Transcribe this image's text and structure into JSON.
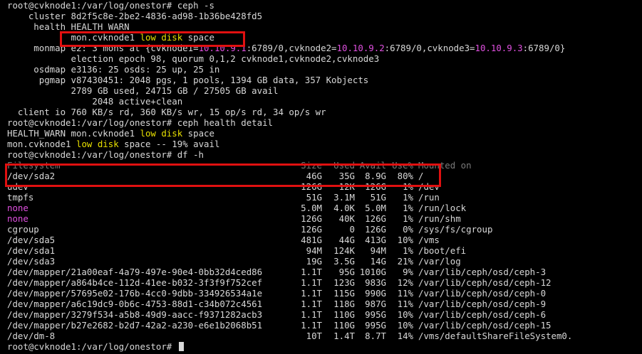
{
  "prompt": "root@cvknode1:/var/log/onestor#",
  "lines": [
    {
      "segs": [
        {
          "t": "root@cvknode1:/var/log/onestor# ceph -s"
        }
      ]
    },
    {
      "segs": [
        {
          "t": "    cluster 8d2f5c8e-2be2-4836-ad98-1b36be428fd5"
        }
      ]
    },
    {
      "segs": [
        {
          "t": "     health HEALTH_WARN"
        }
      ]
    },
    {
      "segs": [
        {
          "t": "            mon.cvknode1 "
        },
        {
          "t": "low disk",
          "c": "yellow"
        },
        {
          "t": " space"
        }
      ]
    },
    {
      "segs": [
        {
          "t": "     monmap e2: 3 mons at {cvknode1="
        },
        {
          "t": "10.10.9.1",
          "c": "magenta"
        },
        {
          "t": ":6789/0,cvknode2="
        },
        {
          "t": "10.10.9.2",
          "c": "magenta"
        },
        {
          "t": ":6789/0,cvknode3="
        },
        {
          "t": "10.10.9.3",
          "c": "magenta"
        },
        {
          "t": ":6789/0}"
        }
      ]
    },
    {
      "segs": [
        {
          "t": "            election epoch 98, quorum 0,1,2 cvknode1,cvknode2,cvknode3"
        }
      ]
    },
    {
      "segs": [
        {
          "t": "     osdmap e3136: 25 osds: 25 up, 25 in"
        }
      ]
    },
    {
      "segs": [
        {
          "t": "      pgmap v87430451: 2048 pgs, 1 pools, 1394 GB data, 357 Kobjects"
        }
      ]
    },
    {
      "segs": [
        {
          "t": "            2789 GB used, 24715 GB / 27505 GB avail"
        }
      ]
    },
    {
      "segs": [
        {
          "t": "                2048 active+clean"
        }
      ]
    },
    {
      "segs": [
        {
          "t": "  client io 760 KB/s rd, 360 KB/s wr, 15 op/s rd, 34 op/s wr"
        }
      ]
    },
    {
      "segs": [
        {
          "t": "root@cvknode1:/var/log/onestor# ceph health detail"
        }
      ]
    },
    {
      "segs": [
        {
          "t": "HEALTH_WARN mon.cvknode1 "
        },
        {
          "t": "low disk",
          "c": "yellow"
        },
        {
          "t": " space"
        }
      ]
    },
    {
      "segs": [
        {
          "t": "mon.cvknode1 "
        },
        {
          "t": "low disk",
          "c": "yellow"
        },
        {
          "t": " space -- 19% avail"
        }
      ]
    },
    {
      "segs": [
        {
          "t": "root@cvknode1:/var/log/onestor# df -h"
        }
      ]
    }
  ],
  "df": {
    "header": {
      "fs": "Filesystem",
      "size": "Size",
      "used": "Used",
      "avail": "Avail",
      "pct": "Use%",
      "mnt": "Mounted on"
    },
    "rows": [
      {
        "fs": "/dev/sda2",
        "size": "46G",
        "used": "35G",
        "avail": "8.9G",
        "pct": "80%",
        "mnt": "/"
      },
      {
        "fs": "udev",
        "size": "126G",
        "used": "12K",
        "avail": "126G",
        "pct": "1%",
        "mnt": "/dev"
      },
      {
        "fs": "tmpfs",
        "size": "51G",
        "used": "3.1M",
        "avail": "51G",
        "pct": "1%",
        "mnt": "/run"
      },
      {
        "fs": "none",
        "size": "5.0M",
        "used": "4.0K",
        "avail": "5.0M",
        "pct": "1%",
        "mnt": "/run/lock",
        "fsColor": "magenta"
      },
      {
        "fs": "none",
        "size": "126G",
        "used": "40K",
        "avail": "126G",
        "pct": "1%",
        "mnt": "/run/shm",
        "fsColor": "magenta"
      },
      {
        "fs": "cgroup",
        "size": "126G",
        "used": "0",
        "avail": "126G",
        "pct": "0%",
        "mnt": "/sys/fs/cgroup"
      },
      {
        "fs": "/dev/sda5",
        "size": "481G",
        "used": "44G",
        "avail": "413G",
        "pct": "10%",
        "mnt": "/vms"
      },
      {
        "fs": "/dev/sda1",
        "size": "94M",
        "used": "124K",
        "avail": "94M",
        "pct": "1%",
        "mnt": "/boot/efi"
      },
      {
        "fs": "/dev/sda3",
        "size": "19G",
        "used": "3.5G",
        "avail": "14G",
        "pct": "21%",
        "mnt": "/var/log"
      },
      {
        "fs": "/dev/mapper/21a00eaf-4a79-497e-90e4-0bb32d4ced86",
        "size": "1.1T",
        "used": "95G",
        "avail": "1010G",
        "pct": "9%",
        "mnt": "/var/lib/ceph/osd/ceph-3"
      },
      {
        "fs": "/dev/mapper/a864b4ce-112d-41ee-b032-3f3f9f752cef",
        "size": "1.1T",
        "used": "123G",
        "avail": "983G",
        "pct": "12%",
        "mnt": "/var/lib/ceph/osd/ceph-12"
      },
      {
        "fs": "/dev/mapper/57695e02-176b-4cc0-9dbb-334926534a1e",
        "size": "1.1T",
        "used": "115G",
        "avail": "990G",
        "pct": "11%",
        "mnt": "/var/lib/ceph/osd/ceph-0"
      },
      {
        "fs": "/dev/mapper/a6c19dc9-0b6c-4753-88d1-c34b072c4561",
        "size": "1.1T",
        "used": "118G",
        "avail": "987G",
        "pct": "11%",
        "mnt": "/var/lib/ceph/osd/ceph-9"
      },
      {
        "fs": "/dev/mapper/3279f534-a5b8-49d9-aacc-f9371282acb3",
        "size": "1.1T",
        "used": "110G",
        "avail": "995G",
        "pct": "10%",
        "mnt": "/var/lib/ceph/osd/ceph-6"
      },
      {
        "fs": "/dev/mapper/b27e2682-b2d7-42a2-a230-e6e1b2068b51",
        "size": "1.1T",
        "used": "110G",
        "avail": "995G",
        "pct": "10%",
        "mnt": "/var/lib/ceph/osd/ceph-15"
      },
      {
        "fs": "/dev/dm-8",
        "size": "10T",
        "used": "1.4T",
        "avail": "8.7T",
        "pct": "14%",
        "mnt": "/vms/defaultShareFileSystem0."
      }
    ]
  },
  "colors": {
    "yellow": "#e8e000",
    "magenta": "#e050e0",
    "highlight": "#e01010",
    "text": "#d8d8d8"
  }
}
